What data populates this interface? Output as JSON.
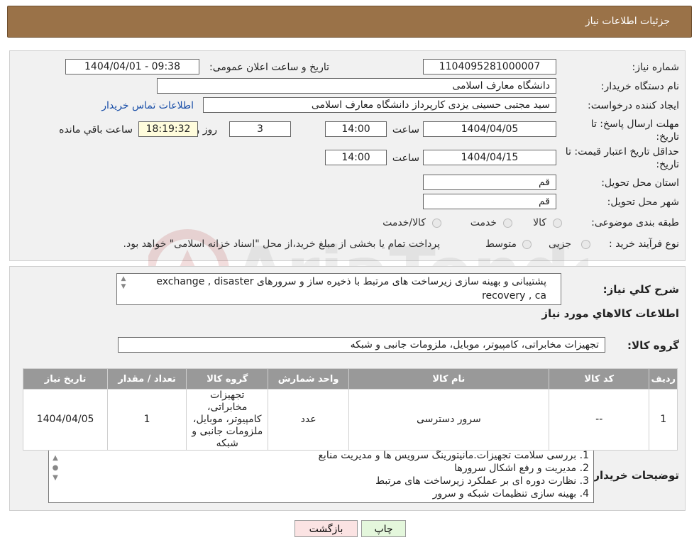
{
  "header": {
    "title": "جزئیات اطلاعات نیاز"
  },
  "fields": {
    "need_number_label": "شماره نیاز:",
    "need_number": "1104095281000007",
    "announce_label": "تاریخ و ساعت اعلان عمومی:",
    "announce_value": "1404/04/01 - 09:38",
    "buyer_org_label": "نام دستگاه خریدار:",
    "buyer_org": "دانشگاه معارف اسلامی",
    "requester_label": "ایجاد کننده درخواست:",
    "requester": "سید مجتبی حسینی یزدی کارپرداز دانشگاه معارف اسلامی",
    "contact_link": "اطلاعات تماس خریدار",
    "deadline_label_1": "مهلت ارسال پاسخ: تا",
    "deadline_label_2": "تاریخ:",
    "deadline_date": "1404/04/05",
    "time_label": "ساعت",
    "deadline_time": "14:00",
    "days_value": "3",
    "days_label": "روز و",
    "remaining_time": "18:19:32",
    "remaining_label": "ساعت باقي مانده",
    "validity_label_1": "حداقل تاریخ اعتبار قیمت: تا",
    "validity_label_2": "تاریخ:",
    "validity_date": "1404/04/15",
    "validity_time_label": "ساعت",
    "validity_time": "14:00",
    "province_label": "استان محل تحویل:",
    "province": "قم",
    "city_label": "شهر محل تحویل:",
    "city": "قم",
    "category_label": "طبقه بندی موضوعی:",
    "category_options": [
      "کالا",
      "خدمت",
      "کالا/خدمت"
    ],
    "process_label": "نوع فرآیند خرید :",
    "process_options": [
      "جزیی",
      "متوسط"
    ],
    "process_note": "پرداخت تمام یا بخشی از مبلغ خرید،از محل \"اسناد خزانه اسلامی\" خواهد بود."
  },
  "description": {
    "label": "شرح كلي نياز:",
    "text": "پشتیبانی و بهینه سازی زیرساخت های مرتبط با ذخیره ساز و سرورهای exchange , disaster recovery , ca"
  },
  "goods": {
    "section_title": "اطلاعات كالاهاي مورد نياز",
    "group_label": "گروه كالا:",
    "group_value": "تجهیزات مخابراتی، کامپیوتر، موبایل، ملزومات جانبی و شبکه",
    "columns": [
      "رديف",
      "کد کالا",
      "نام کالا",
      "واحد شمارش",
      "گروه کالا",
      "تعداد / مقدار",
      "تاریخ نیاز"
    ],
    "rows": [
      [
        "1",
        "--",
        "سرور دسترسی",
        "عدد",
        "تجهیزات مخابراتی، کامپیوتر، موبایل، ملزومات جانبی و شبکه",
        "1",
        "1404/04/05"
      ]
    ]
  },
  "buyer_notes": {
    "label": "توضیحات خریدار:",
    "lines": [
      "1. بررسی سلامت تجهیزات.مانیتورینگ سرویس ها و مدیریت منابع",
      "2. مدیریت و رفع اشکال سرورها",
      "3. نظارت دوره ای بر عملکرد زیرساخت های مرتبط",
      "4. بهینه سازی تنظیمات شبکه و سرور"
    ]
  },
  "buttons": {
    "print": "چاپ",
    "back": "بازگشت"
  },
  "colors": {
    "header_bg": "#9a7248",
    "print_bg": "#e4f7dc",
    "back_bg": "#fbe3e3",
    "link": "#1a4fa8"
  }
}
